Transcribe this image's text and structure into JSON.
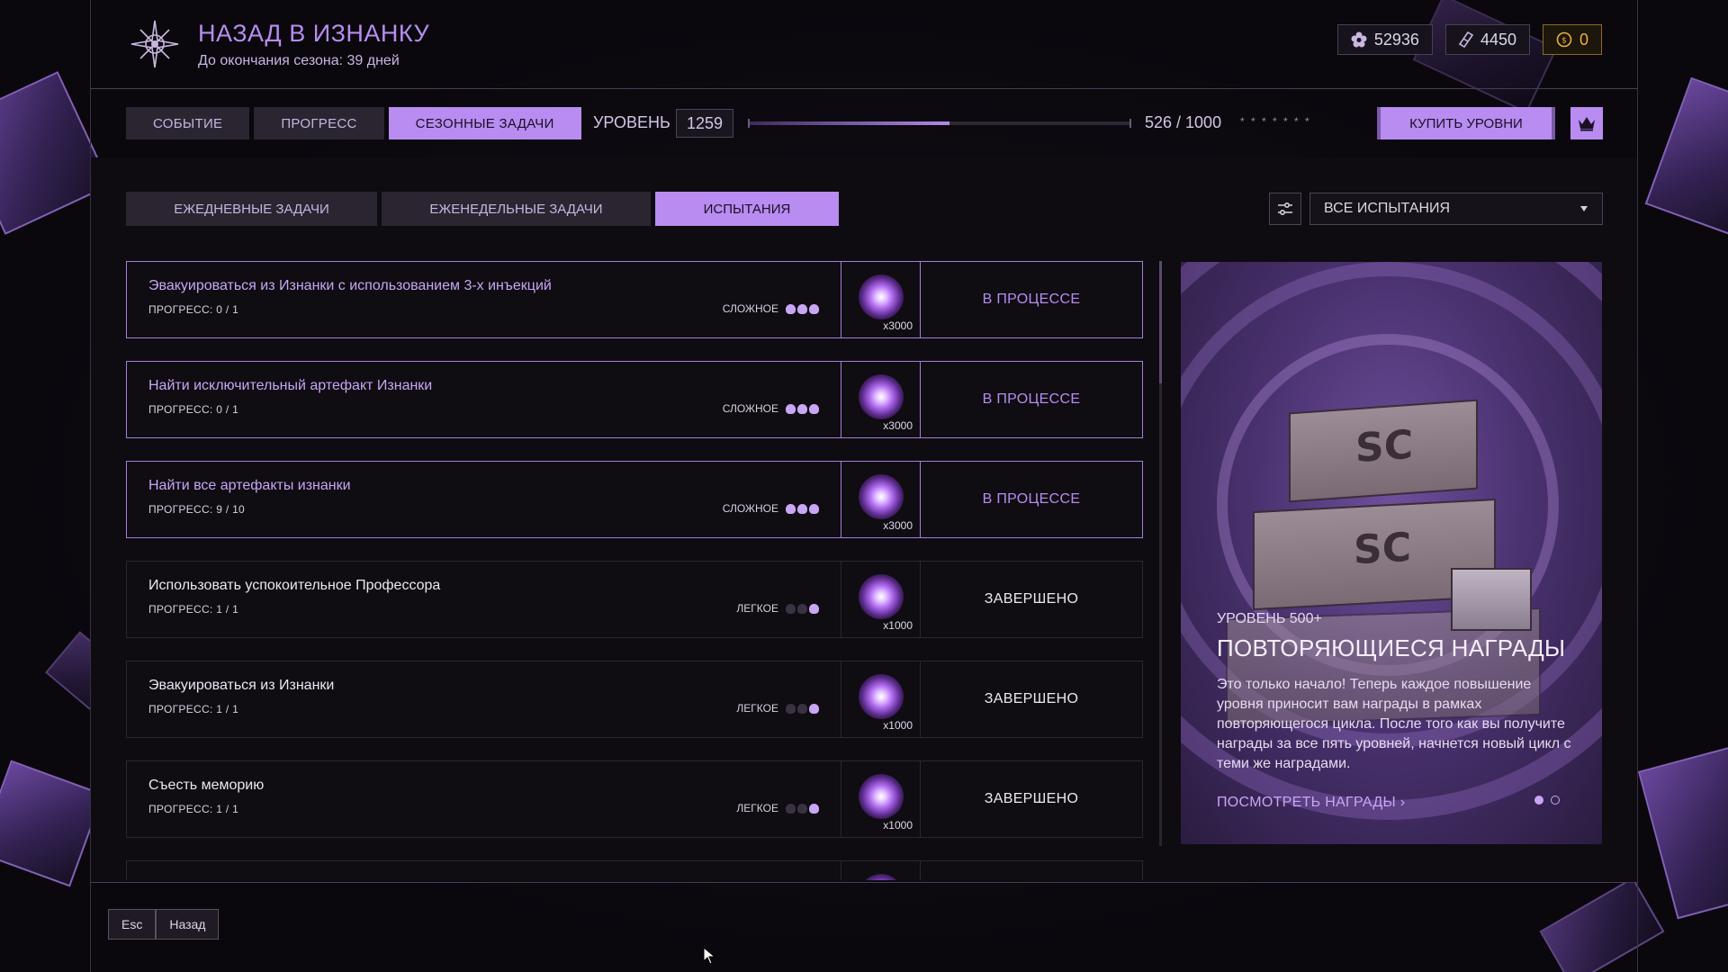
{
  "header": {
    "title": "НАЗАД В ИЗНАНКУ",
    "season_text": "До окончания сезона: 39 дней"
  },
  "currencies": [
    {
      "icon": "flower-icon",
      "value": "52936"
    },
    {
      "icon": "ticket-icon",
      "value": "4450"
    },
    {
      "icon": "coin-icon",
      "value": "0"
    }
  ],
  "nav": {
    "tabs": [
      "СОБЫТИЕ",
      "ПРОГРЕСС",
      "СЕЗОННЫЕ ЗАДАЧИ"
    ],
    "active_tab": "СЕЗОННЫЕ ЗАДАЧИ"
  },
  "level": {
    "label": "УРОВЕНЬ",
    "value": "1259",
    "progress_text": "526 / 1000",
    "progress_fraction": 0.526,
    "stars": "* * * * * * *"
  },
  "buy_levels_label": "КУПИТЬ УРОВНИ",
  "subtabs": {
    "items": [
      "ЕЖЕДНЕВНЫЕ ЗАДАЧИ",
      "ЕЖЕНЕДЕЛЬНЫЕ ЗАДАЧИ",
      "ИСПЫТАНИЯ"
    ],
    "active": "ИСПЫТАНИЯ"
  },
  "filter": {
    "selected": "ВСЕ ИСПЫТАНИЯ"
  },
  "tasks": [
    {
      "name": "Эвакуироваться из Изнанки с использованием 3-х инъекций",
      "progress": "ПРОГРЕСС: 0 / 1",
      "difficulty": "СЛОЖНОЕ",
      "skulls": 3,
      "reward": "x3000",
      "status": "В ПРОЦЕССЕ"
    },
    {
      "name": "Найти исключительный артефакт Изнанки",
      "progress": "ПРОГРЕСС: 0 / 1",
      "difficulty": "СЛОЖНОЕ",
      "skulls": 3,
      "reward": "x3000",
      "status": "В ПРОЦЕССЕ"
    },
    {
      "name": "Найти все артефакты изнанки",
      "progress": "ПРОГРЕСС: 9 / 10",
      "difficulty": "СЛОЖНОЕ",
      "skulls": 3,
      "reward": "x3000",
      "status": "В ПРОЦЕССЕ"
    },
    {
      "name": "Использовать успокоительное Профессора",
      "progress": "ПРОГРЕСС: 1 / 1",
      "difficulty": "ЛЕГКОЕ",
      "skulls": 1,
      "reward": "x1000",
      "status": "ЗАВЕРШЕНО"
    },
    {
      "name": "Эвакуироваться из Изнанки",
      "progress": "ПРОГРЕСС: 1 / 1",
      "difficulty": "ЛЕГКОЕ",
      "skulls": 1,
      "reward": "x1000",
      "status": "ЗАВЕРШЕНО"
    },
    {
      "name": "Съесть меморию",
      "progress": "ПРОГРЕСС: 1 / 1",
      "difficulty": "ЛЕГКОЕ",
      "skulls": 1,
      "reward": "x1000",
      "status": "ЗАВЕРШЕНО"
    }
  ],
  "promo": {
    "subtitle": "УРОВЕНЬ 500+",
    "title": "ПОВТОРЯЮЩИЕСЯ НАГРАДЫ",
    "description": "Это только начало! Теперь каждое повышение уровня приносит вам награды в рамках повторяющегося цикла. После того как вы получите награды за все пять уровней, начнется новый цикл с теми же наградами.",
    "link": "ПОСМОТРЕТЬ НАГРАДЫ",
    "crate_label": "SC"
  },
  "bottom": {
    "esc_key": "Esc",
    "back_label": "Назад"
  },
  "colors": {
    "accent": "#b98cf2",
    "accent_text": "#b78df0",
    "background": "#0c0910",
    "gold": "#e8b042"
  }
}
